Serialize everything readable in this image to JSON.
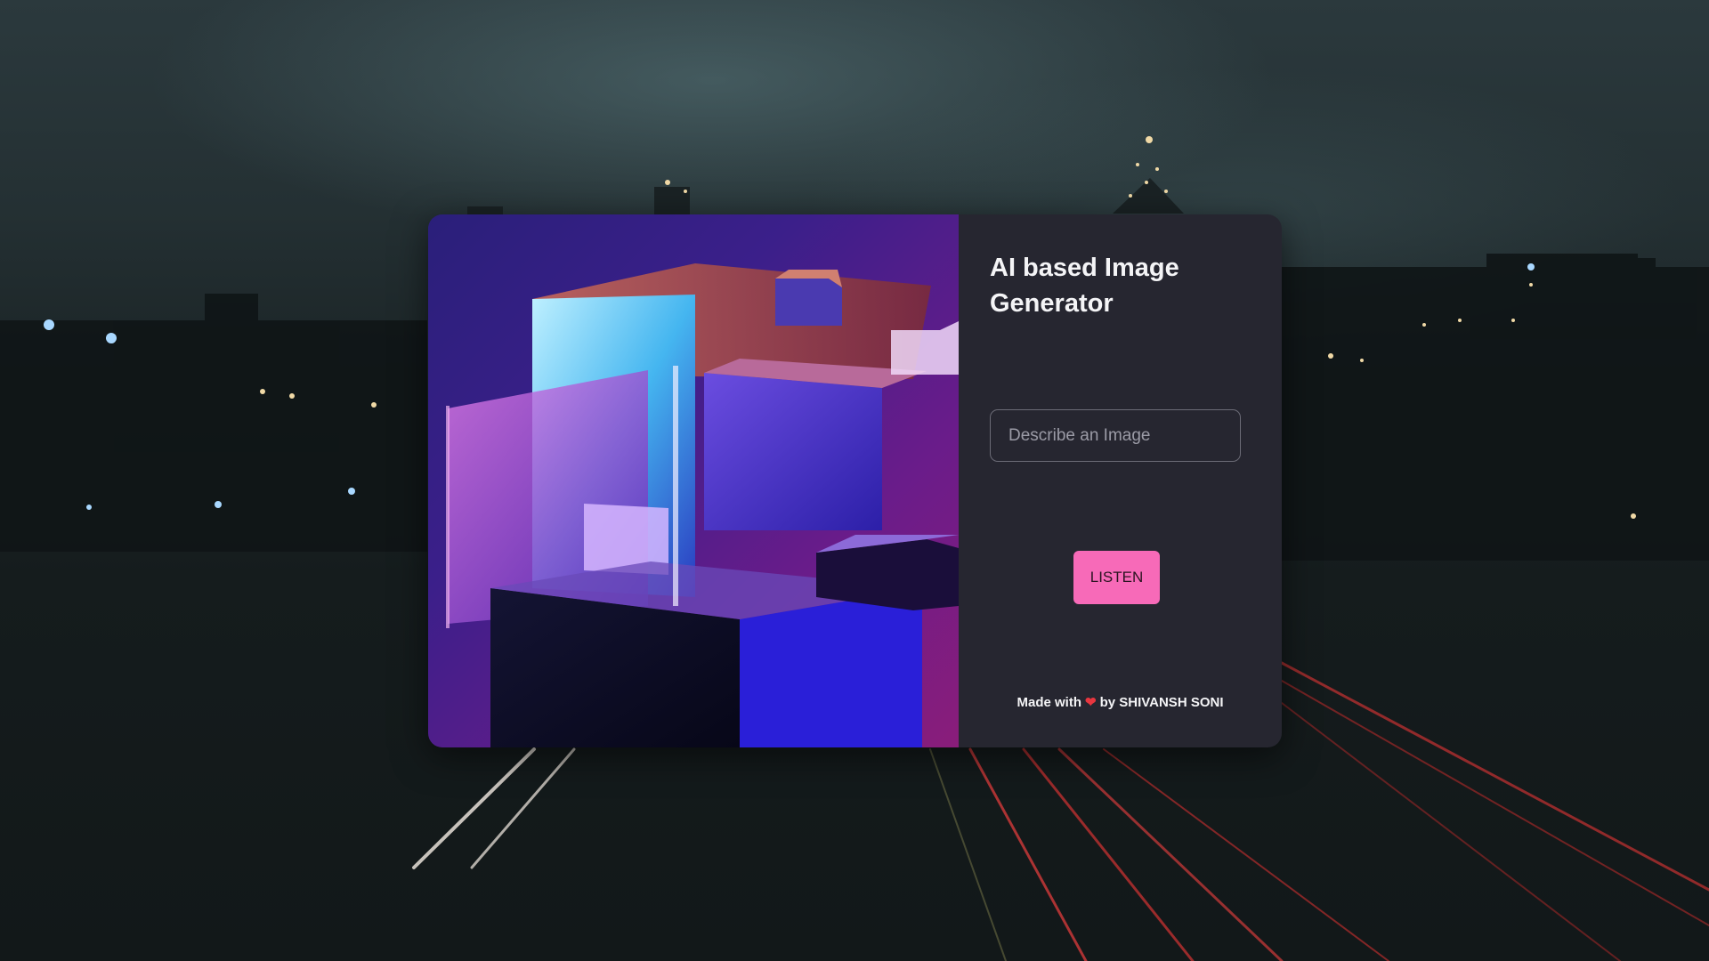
{
  "app": {
    "title": "AI based Image Generator"
  },
  "form": {
    "prompt_placeholder": "Describe an Image",
    "prompt_value": "",
    "listen_label": "LISTEN"
  },
  "footer": {
    "made_with": "Made with",
    "heart_icon": "heart-icon",
    "by_text": "by SHIVANSH SONI"
  },
  "colors": {
    "panel": "#262630",
    "button": "#f76ab8",
    "heart": "#e8363f",
    "text": "#f4f4f6"
  }
}
